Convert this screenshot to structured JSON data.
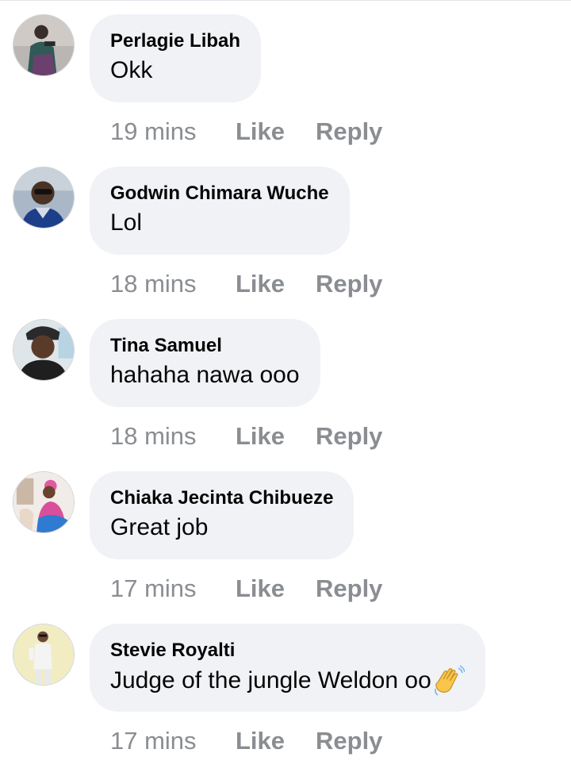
{
  "comments": [
    {
      "author": "Perlagie Libah",
      "text": "Okk",
      "time": "19 mins",
      "like": "Like",
      "reply": "Reply"
    },
    {
      "author": "Godwin Chimara Wuche",
      "text": "Lol",
      "time": "18 mins",
      "like": "Like",
      "reply": "Reply"
    },
    {
      "author": "Tina Samuel",
      "text": "hahaha nawa ooo",
      "time": "18 mins",
      "like": "Like",
      "reply": "Reply"
    },
    {
      "author": "Chiaka Jecinta Chibueze",
      "text": "Great job",
      "time": "17 mins",
      "like": "Like",
      "reply": "Reply"
    },
    {
      "author": "Stevie Royalti",
      "text": "Judge of the jungle Weldon oo",
      "emoji": "waving-hand-icon",
      "time": "17 mins",
      "like": "Like",
      "reply": "Reply"
    }
  ],
  "colors": {
    "bubble": "#f0f2f5",
    "text": "#050505",
    "meta": "#8a8d91"
  }
}
